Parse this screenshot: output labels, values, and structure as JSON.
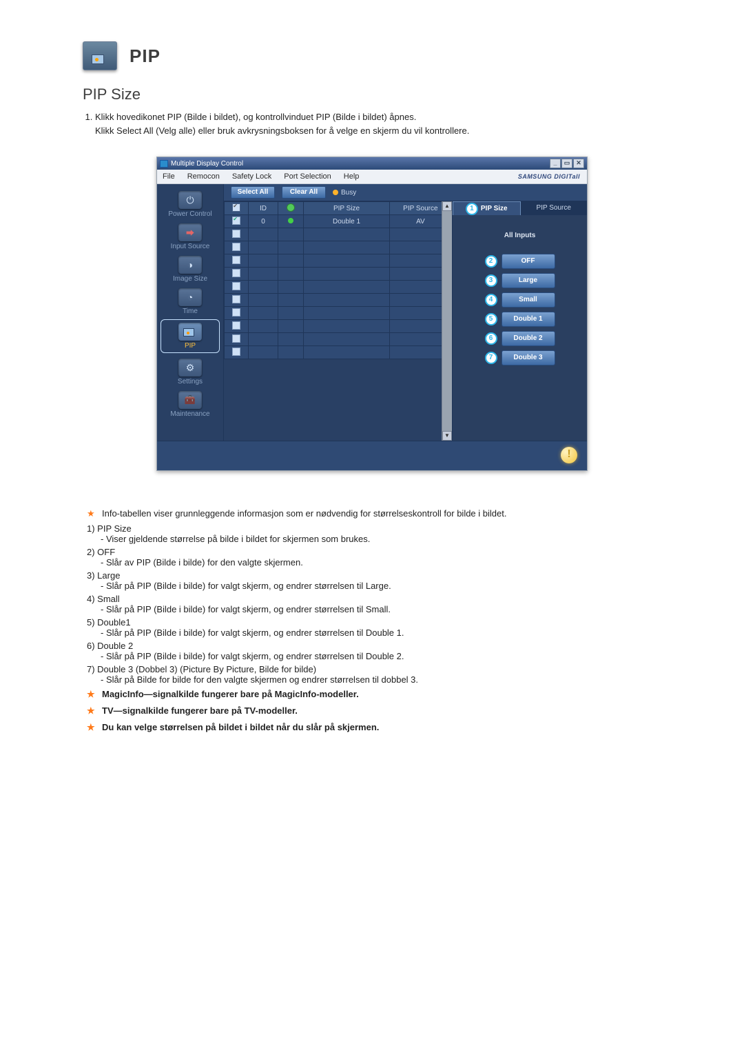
{
  "title": "PIP",
  "section": "PIP Size",
  "intro": {
    "line1": "Klikk hovedikonet PIP (Bilde i bildet), og kontrollvinduet PIP (Bilde i bildet) åpnes.",
    "line2": "Klikk Select All (Velg alle) eller bruk avkrysningsboksen for å velge en skjerm du vil kontrollere."
  },
  "window": {
    "title": "Multiple Display Control",
    "menu": [
      "File",
      "Remocon",
      "Safety Lock",
      "Port Selection",
      "Help"
    ],
    "brand": "SAMSUNG DIGITall",
    "winbtns": [
      "_",
      "▭",
      "✕"
    ]
  },
  "sidebar": [
    {
      "label": "Power Control"
    },
    {
      "label": "Input Source"
    },
    {
      "label": "Image Size"
    },
    {
      "label": "Time"
    },
    {
      "label": "PIP"
    },
    {
      "label": "Settings"
    },
    {
      "label": "Maintenance"
    }
  ],
  "toolbar": {
    "select_all": "Select All",
    "clear_all": "Clear All",
    "busy": "Busy"
  },
  "table": {
    "headers": {
      "id": "ID",
      "pip_size": "PIP Size",
      "pip_source": "PIP Source"
    },
    "rows": [
      {
        "checked": true,
        "id": "0",
        "pip_size": "Double 1",
        "pip_source": "AV"
      },
      {
        "checked": false
      },
      {
        "checked": false
      },
      {
        "checked": false
      },
      {
        "checked": false
      },
      {
        "checked": false
      },
      {
        "checked": false
      },
      {
        "checked": false
      },
      {
        "checked": false
      },
      {
        "checked": false
      },
      {
        "checked": false
      }
    ],
    "scroll_up": "▲",
    "scroll_down": "▼"
  },
  "right": {
    "tabs": {
      "active": "PIP Size",
      "inactive": "PIP Source"
    },
    "all_inputs": "All Inputs",
    "options": [
      "OFF",
      "Large",
      "Small",
      "Double 1",
      "Double 2",
      "Double 3"
    ],
    "callouts": [
      "1",
      "2",
      "3",
      "4",
      "5",
      "6",
      "7"
    ]
  },
  "bottom": {
    "warn": "!"
  },
  "notes": {
    "star_info": "Info-tabellen viser grunnleggende informasjon som er nødvendig for størrelseskontroll for bilde i bildet.",
    "n1_label": "1)  PIP Size",
    "n1_desc": "- Viser gjeldende størrelse på bilde i bildet for skjermen som brukes.",
    "n2_label": "2)  OFF",
    "n2_desc": "- Slår av PIP (Bilde i bilde) for den valgte skjermen.",
    "n3_label": "3)  Large",
    "n3_desc": "- Slår på PIP (Bilde i bilde) for valgt skjerm, og endrer størrelsen til Large.",
    "n4_label": "4)  Small",
    "n4_desc": "- Slår på PIP (Bilde i bilde) for valgt skjerm, og endrer størrelsen til Small.",
    "n5_label": "5)  Double1",
    "n5_desc": "- Slår på PIP (Bilde i bilde) for valgt skjerm, og endrer størrelsen til Double 1.",
    "n6_label": "6)  Double 2",
    "n6_desc": "- Slår på PIP (Bilde i bilde) for valgt skjerm, og endrer størrelsen til Double 2.",
    "n7_label": "7)  Double 3 (Dobbel 3) (Picture By Picture, Bilde for bilde)",
    "n7_desc": "- Slår på Bilde for bilde for den valgte skjermen og endrer størrelsen til dobbel 3.",
    "star_magicinfo": "MagicInfo—signalkilde fungerer bare på MagicInfo-modeller.",
    "star_tv": "TV—signalkilde fungerer bare på TV-modeller.",
    "star_size": "Du kan velge størrelsen på bildet i bildet når du slår på skjermen."
  }
}
